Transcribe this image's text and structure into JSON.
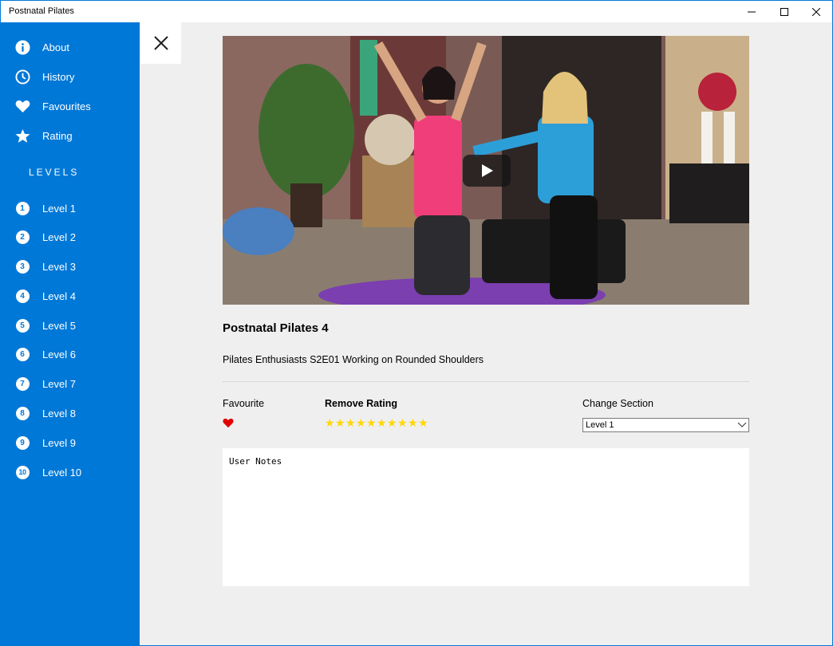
{
  "window": {
    "title": "Postnatal Pilates"
  },
  "sidebar": {
    "accent_color": "#0078d7",
    "menu": [
      {
        "label": "About",
        "icon": "info-icon"
      },
      {
        "label": "History",
        "icon": "clock-icon"
      },
      {
        "label": "Favourites",
        "icon": "heart-icon"
      },
      {
        "label": "Rating",
        "icon": "star-icon"
      }
    ],
    "levels_heading": "LEVELS",
    "levels": [
      {
        "number": "1",
        "label": "Level 1"
      },
      {
        "number": "2",
        "label": "Level 2"
      },
      {
        "number": "3",
        "label": "Level 3"
      },
      {
        "number": "4",
        "label": "Level 4"
      },
      {
        "number": "5",
        "label": "Level 5"
      },
      {
        "number": "6",
        "label": "Level 6"
      },
      {
        "number": "7",
        "label": "Level 7"
      },
      {
        "number": "8",
        "label": "Level 8"
      },
      {
        "number": "9",
        "label": "Level 9"
      },
      {
        "number": "10",
        "label": "Level 10"
      }
    ]
  },
  "detail": {
    "title": "Postnatal Pilates 4",
    "description": "Pilates Enthusiasts S2E01 Working on Rounded Shoulders",
    "favourite_label": "Favourite",
    "favourite_active": true,
    "favourite_color": "#e00000",
    "rating_label": "Remove Rating",
    "rating_stars": 10,
    "rating_max": 10,
    "star_color": "#ffd700",
    "section_label": "Change Section",
    "section_selected": "Level 1",
    "notes_placeholder": "User Notes"
  }
}
